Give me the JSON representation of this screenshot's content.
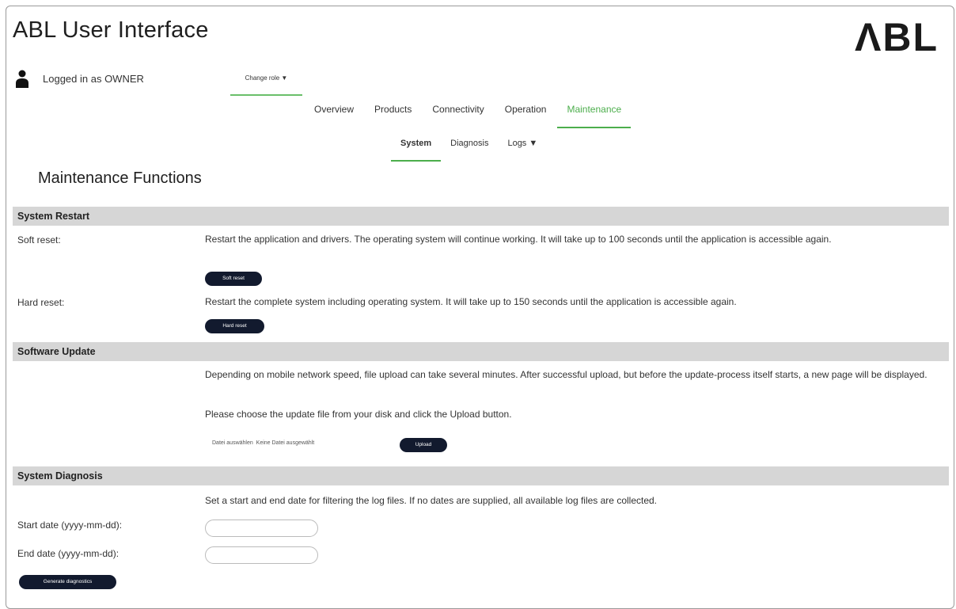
{
  "app": {
    "title": "ABL User Interface",
    "logo_text": "ΛBL"
  },
  "user": {
    "logged_in_text": "Logged in as OWNER",
    "icon": "user-icon",
    "change_role_label": "Change role ▼"
  },
  "nav": {
    "tabs": [
      {
        "label": "Overview"
      },
      {
        "label": "Products"
      },
      {
        "label": "Connectivity"
      },
      {
        "label": "Operation"
      },
      {
        "label": "Maintenance",
        "active": true
      }
    ],
    "subtabs": [
      {
        "label": "System",
        "active": true
      },
      {
        "label": "Diagnosis"
      },
      {
        "label": "Logs ▼"
      }
    ]
  },
  "page": {
    "title": "Maintenance Functions"
  },
  "system_restart": {
    "heading": "System Restart",
    "soft_reset_label": "Soft reset:",
    "soft_reset_desc": "Restart the application and drivers. The operating system will continue working. It will take up to 100 seconds until the application is accessible again.",
    "soft_reset_button": "Soft reset",
    "hard_reset_label": "Hard reset:",
    "hard_reset_desc": "Restart the complete system including operating system. It will take up to 150 seconds until the application is accessible again.",
    "hard_reset_button": "Hard reset"
  },
  "software_update": {
    "heading": "Software Update",
    "desc1": "Depending on mobile network speed, file upload can take several minutes. After successful upload, but before the update-process itself starts, a new page will be displayed.",
    "desc2": "Please choose the update file from your disk and click the Upload button.",
    "file_button": "Datei auswählen",
    "file_status": "Keine Datei ausgewählt",
    "upload_button": "Upload"
  },
  "system_diagnosis": {
    "heading": "System Diagnosis",
    "desc": "Set a start and end date for filtering the log files. If no dates are supplied, all available log files are collected.",
    "start_label": "Start date (yyyy-mm-dd):",
    "start_value": "",
    "end_label": "End date (yyyy-mm-dd):",
    "end_value": "",
    "generate_button": "Generate diagnostics"
  },
  "colors": {
    "accent": "#4cae4c",
    "button_bg": "#121a2e",
    "section_bg": "#d6d6d6"
  }
}
